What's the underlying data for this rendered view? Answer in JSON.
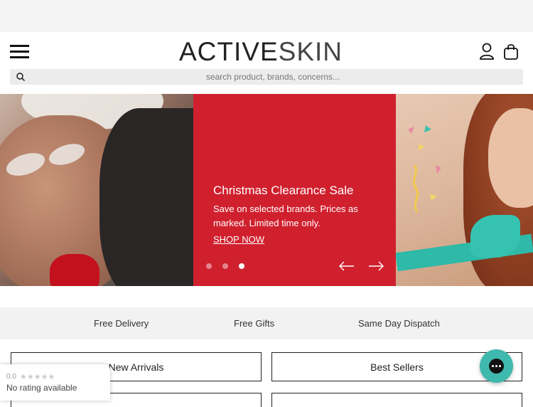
{
  "header": {
    "logo_primary": "ACTIVE",
    "logo_secondary": "SKIN"
  },
  "search": {
    "placeholder": "search product, brands, concerns..."
  },
  "hero": {
    "title": "Christmas Clearance Sale",
    "text": "Save on selected brands. Prices as marked. Limited time only.",
    "link": "SHOP NOW",
    "slide_count": 3,
    "active_slide": 3,
    "accent_color": "#d0202e"
  },
  "usp": {
    "items": [
      "Free Delivery",
      "Free Gifts",
      "Same Day Dispatch"
    ]
  },
  "categories": {
    "items": [
      "New Arrivals",
      "Best Sellers"
    ]
  },
  "rating": {
    "score": "0.0",
    "stars": "★★★★★",
    "text": "No rating available"
  },
  "chat": {
    "color": "#3fb8ae"
  }
}
